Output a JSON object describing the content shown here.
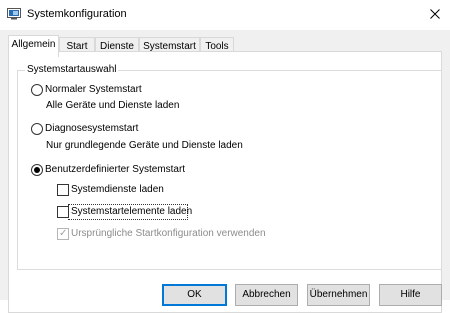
{
  "window": {
    "title": "Systemkonfiguration",
    "app_icon": "msconfig-icon",
    "close_icon": "close-icon"
  },
  "tabs": [
    "Allgemein",
    "Start",
    "Dienste",
    "Systemstart",
    "Tools"
  ],
  "active_tab": "Allgemein",
  "group": {
    "legend": "Systemstartauswahl"
  },
  "options": {
    "normal": {
      "label": "Normaler Systemstart",
      "description": "Alle Geräte und Dienste laden",
      "checked": false
    },
    "diagnostic": {
      "label": "Diagnosesystemstart",
      "description": "Nur grundlegende Geräte und Dienste laden",
      "checked": false
    },
    "selective": {
      "label": "Benutzerdefinierter Systemstart",
      "checked": true
    }
  },
  "checkboxes": {
    "services": {
      "label": "Systemdienste laden",
      "checked": false
    },
    "startup_items": {
      "label": "Systemstartelemente laden",
      "checked": false
    },
    "original_config": {
      "label": "Ursprüngliche Startkonfiguration verwenden",
      "checked": true,
      "disabled": true
    }
  },
  "buttons": {
    "ok": "OK",
    "cancel": "Abbrechen",
    "apply": "Übernehmen",
    "help": "Hilfe"
  }
}
